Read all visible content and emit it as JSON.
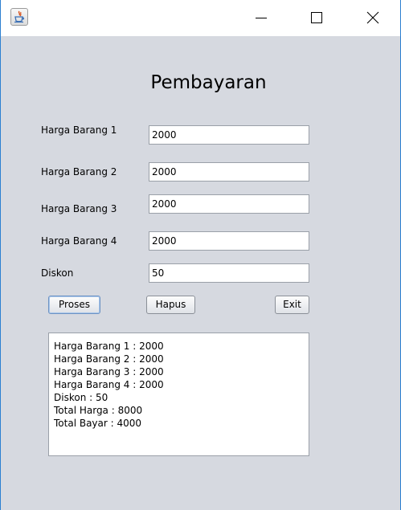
{
  "form": {
    "title": "Pembayaran",
    "fields": [
      {
        "label": "Harga Barang 1",
        "value": "2000"
      },
      {
        "label": "Harga Barang 2",
        "value": "2000"
      },
      {
        "label": "Harga Barang 3",
        "value": "2000"
      },
      {
        "label": "Harga Barang 4",
        "value": "2000"
      },
      {
        "label": "Diskon",
        "value": "50"
      }
    ],
    "buttons": {
      "proses": "Proses",
      "hapus": "Hapus",
      "exit": "Exit"
    },
    "output_lines": [
      "Harga Barang 1 : 2000",
      "Harga Barang 2 : 2000",
      "Harga Barang 3 : 2000",
      "Harga Barang 4 : 2000",
      "Diskon : 50",
      "Total Harga : 8000",
      "Total Bayar : 4000"
    ]
  }
}
